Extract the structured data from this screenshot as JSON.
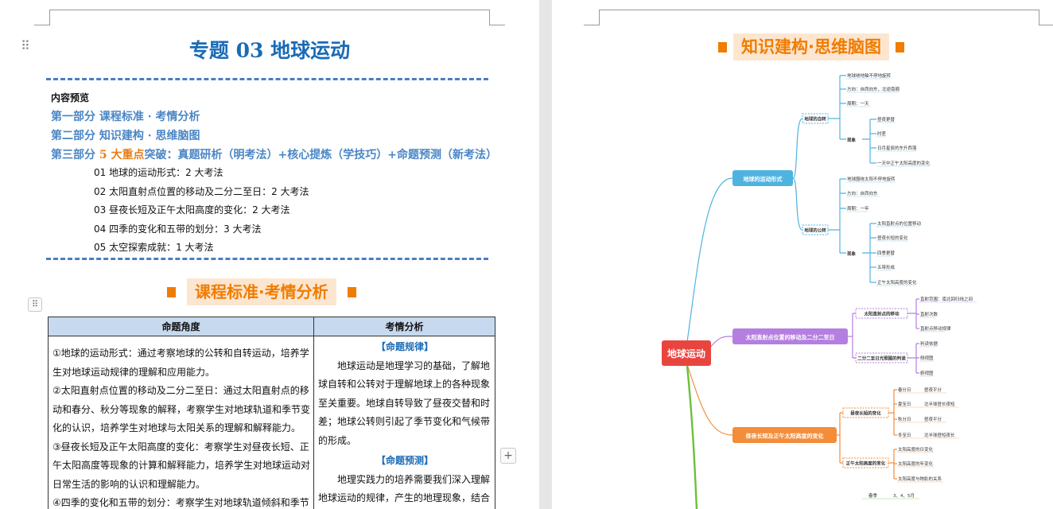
{
  "document": {
    "title": "专题 03  地球运动",
    "preview_heading": "内容预览",
    "parts": [
      {
        "text": "第一部分  课程标准 · 考情分析"
      },
      {
        "text": "第二部分  知识建构 · 思维脑图"
      },
      {
        "prefix": "第三部分  ",
        "highlight": "5 大重点",
        "suffix": "突破：真题研析（明考法）+核心提炼（学技巧）+命题预测（新考法）"
      }
    ],
    "subitems": [
      "01 地球的运动形式：2 大考法",
      "02 太阳直射点位置的移动及二分二至日：2 大考法",
      "03 昼夜长短及正午太阳高度的变化：2 大考法",
      "04 四季的变化和五带的划分：3 大考法",
      "05 太空探索成就：1 大考法"
    ],
    "section_banner": "课程标准·考情分析",
    "table": {
      "headers": [
        "命题角度",
        "考情分析"
      ],
      "left_items": [
        "①地球的运动形式：通过考察地球的公转和自转运动，培养学生对地球运动规律的理解和应用能力。",
        "②太阳直射点位置的移动及二分二至日：通过太阳直射点的移动和春分、秋分等现象的解释，考察学生对地球轨道和季节变化的认识，培养学生对地球与太阳关系的理解和解释能力。",
        "③昼夜长短及正午太阳高度的变化：考察学生对昼夜长短、正午太阳高度等现象的计算和解释能力，培养学生对地球运动对日常生活的影响的认识和理解能力。",
        "④四季的变化和五带的划分：考察学生对地球轨道倾斜和季节"
      ],
      "rule_heading": "【命题规律】",
      "rule_text": "地球运动是地理学习的基础，了解地球自转和公转对于理解地球上的各种现象至关重要。地球自转导致了昼夜交替和时差；地球公转则引起了季节变化和气候带的形成。",
      "forecast_heading": "【命题预测】",
      "forecast_text": "地理实践力的培养需要我们深入理解地球运动的规律，产生的地理现象，结合"
    }
  },
  "mindmap": {
    "banner": "知识建构·思维脑图",
    "root": "地球运动",
    "branches": [
      {
        "label": "地球的运动形式",
        "color": "#4fb3e0"
      },
      {
        "label": "太阳直射点位置的移动及二分二至日",
        "color": "#b47fe0"
      },
      {
        "label": "昼夜长短及正午太阳高度的变化",
        "color": "#f38d3a"
      }
    ],
    "nodes": {
      "zizhuan": "地球的自转",
      "gongzhuan": "地球的公转",
      "zhishe_move": "太阳直射点的移动",
      "erfen": "二分二至日光照图的判读",
      "zhouye": "昼夜长短的变化",
      "zhengwu": "正午太阳高度的变化",
      "xianxiang": "现象"
    },
    "leaves_a1": [
      "地球绕地轴不停地旋转",
      "方向：自西向东，北逆南顺",
      "周期：一天"
    ],
    "leaves_a1x": [
      "昼夜更替",
      "时差",
      "日月星辰的东升西落",
      "一天中正午太阳高度的变化"
    ],
    "leaves_a2": [
      "地球围绕太阳不停地旋转",
      "方向：自西向东",
      "周期：一年"
    ],
    "leaves_a2x": [
      "太阳直射点的位置移动",
      "昼夜长短的变化",
      "四季更替",
      "五带形成",
      "正午太阳高度的变化"
    ],
    "leaves_b1": [
      "直射范围：南北回归线之间",
      "直射次数",
      "直射点移动规律"
    ],
    "leaves_b2": [
      "判读依据",
      "侧视图",
      "俯视图"
    ],
    "leaves_c1": [
      {
        "a": "春分日",
        "b": "昼夜平分"
      },
      {
        "a": "夏至日",
        "b": "北半球昼长夜短"
      },
      {
        "a": "秋分日",
        "b": "昼夜平分"
      },
      {
        "a": "冬至日",
        "b": "北半球昼短夜长"
      }
    ],
    "leaves_c2": [
      "太阳高度的日变化",
      "太阳高度的年变化",
      "太阳高度与物影的关系"
    ],
    "bottom": [
      "春季",
      "3、4、5月"
    ]
  },
  "ui": {
    "add_symbol": "+",
    "table_handle": "⠿",
    "drag_handle": "⠿"
  }
}
